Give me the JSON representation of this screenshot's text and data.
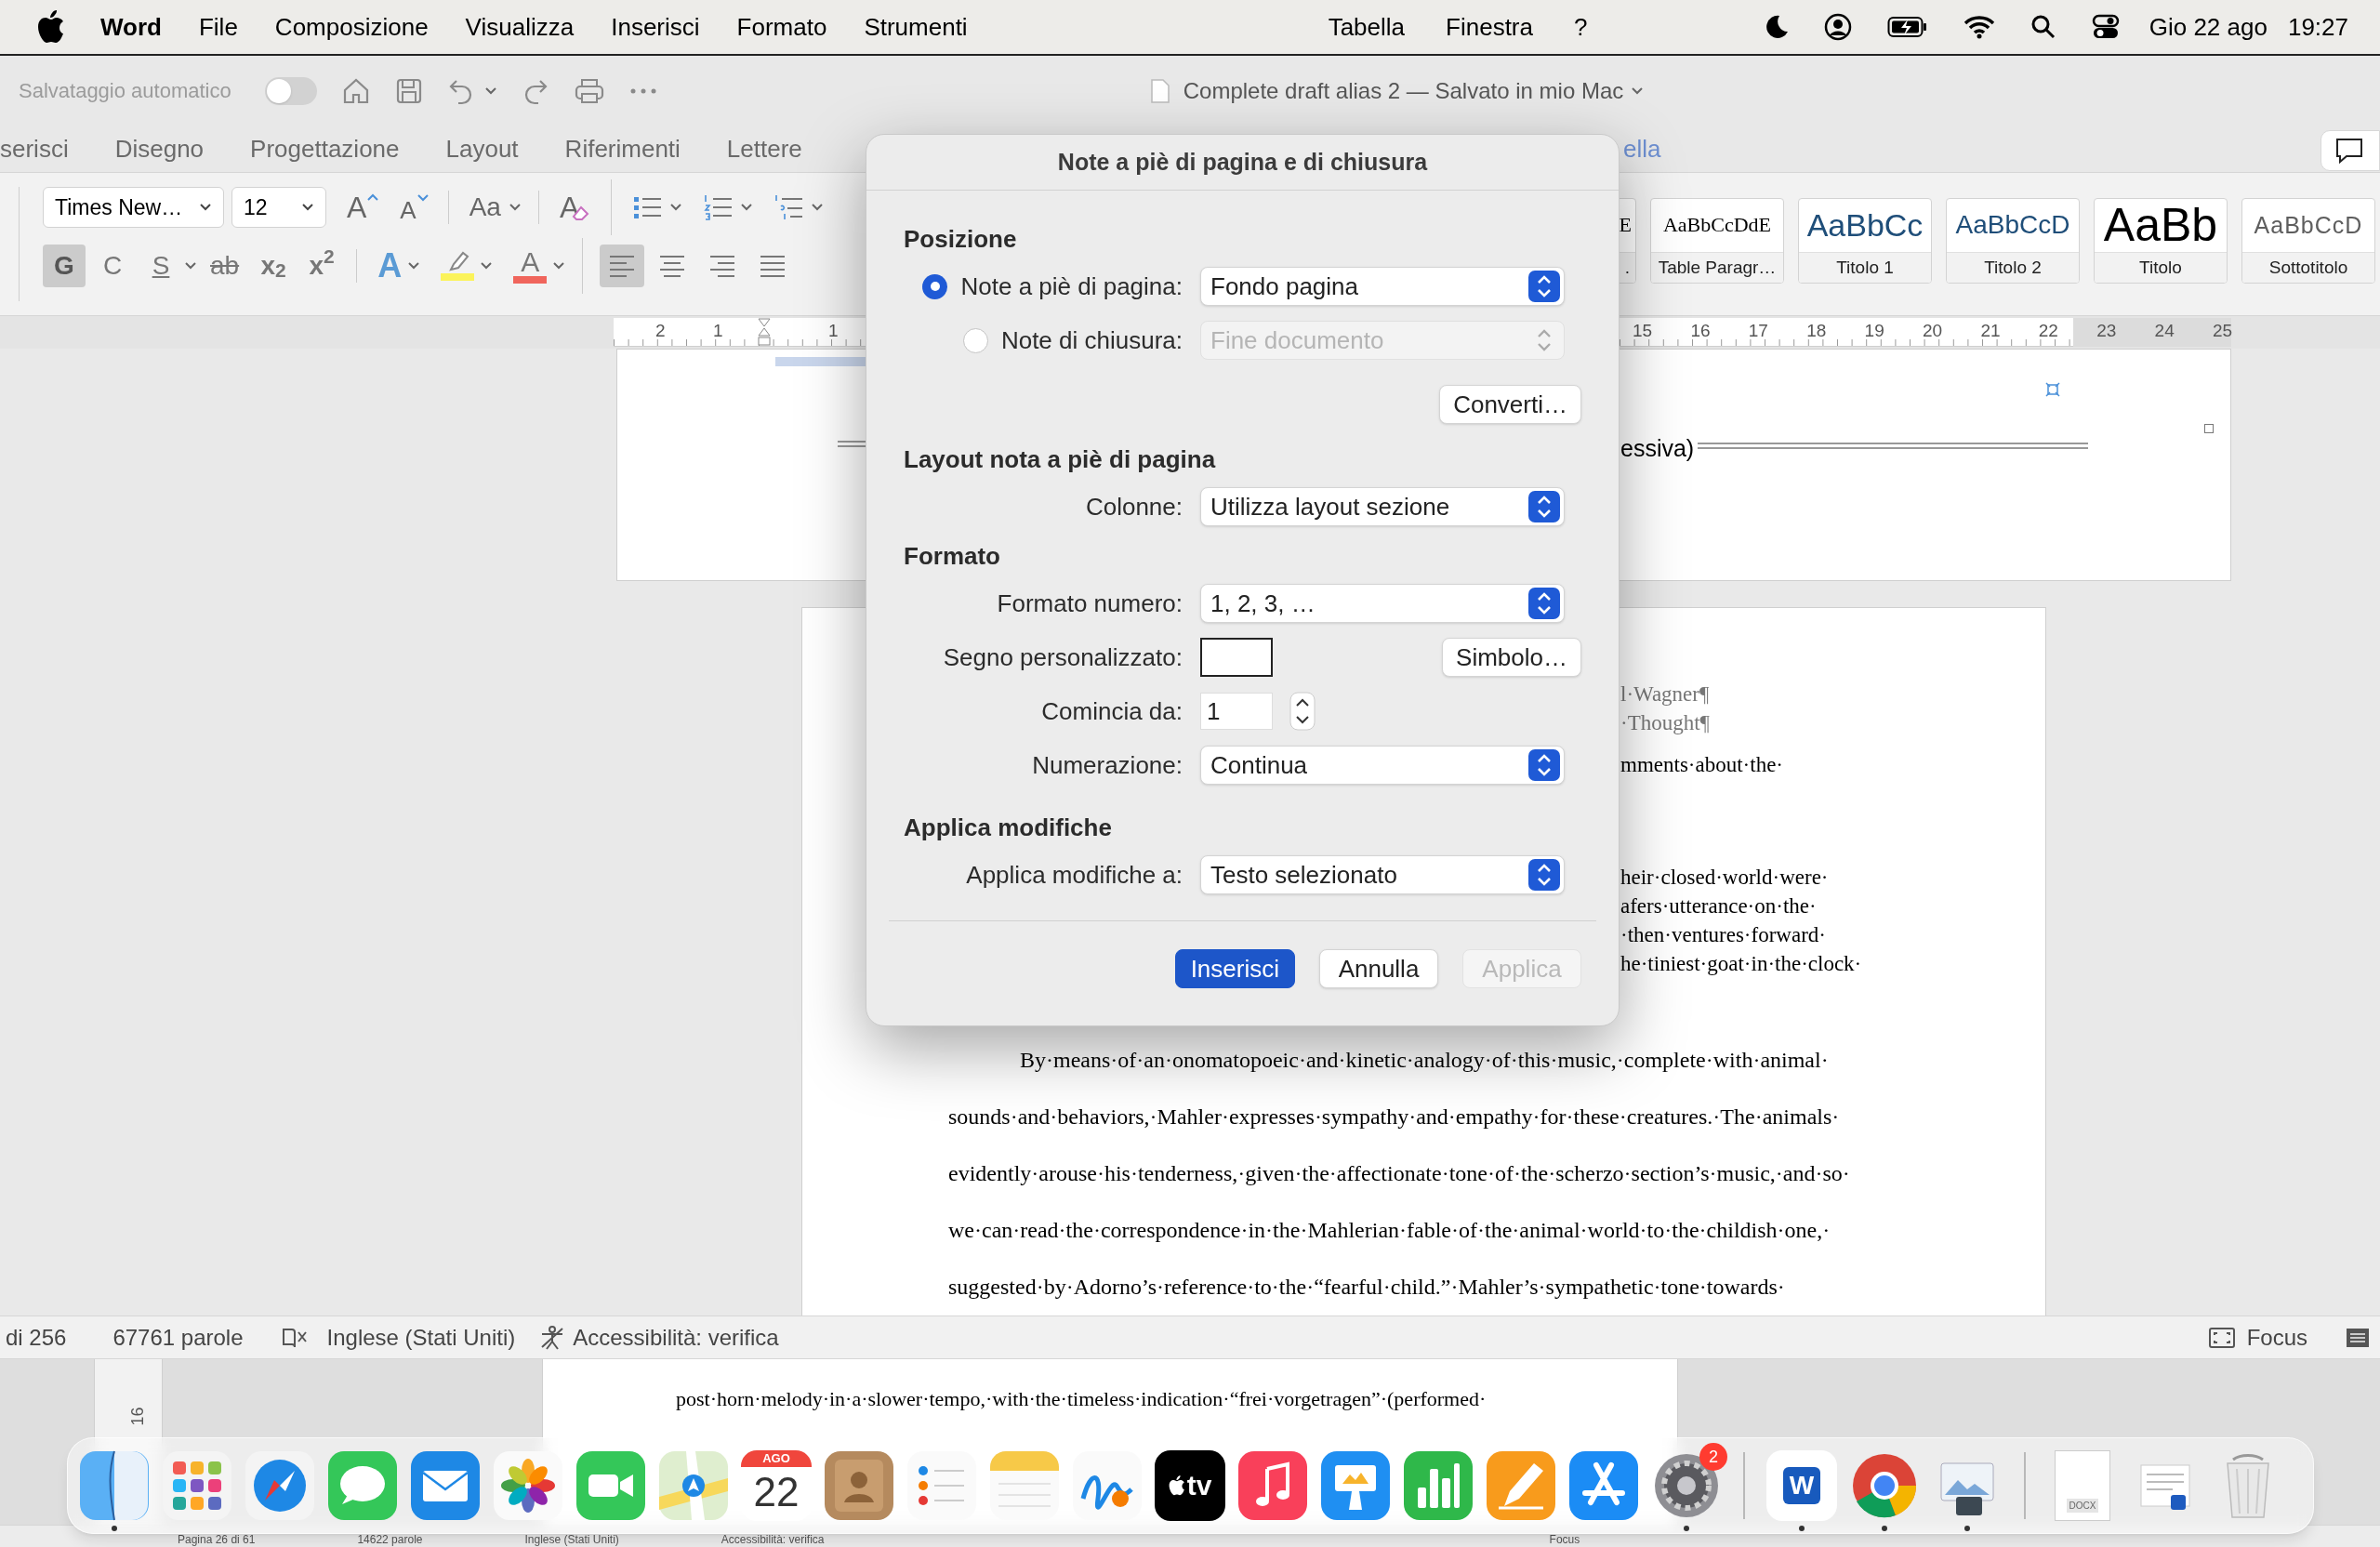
{
  "menu_bar": {
    "app_name": "Word",
    "menus": [
      "File",
      "Composizione",
      "Visualizza",
      "Inserisci",
      "Formato",
      "Strumenti"
    ],
    "extra_menus": [
      "Tabella",
      "Finestra",
      "?"
    ],
    "date": "Gio 22 ago",
    "time": "19:27"
  },
  "toolbar": {
    "autosave_label": "Salvataggio automatico",
    "autosave_on": false,
    "document_title": "Complete draft alias 2 — Salvato in mio Mac"
  },
  "ribbon_tabs": [
    {
      "label": "serisci",
      "contextual": false
    },
    {
      "label": "Disegno",
      "contextual": false
    },
    {
      "label": "Progettazione",
      "contextual": false
    },
    {
      "label": "Layout",
      "contextual": false
    },
    {
      "label": "Riferimenti",
      "contextual": false
    },
    {
      "label": "Lettere",
      "contextual": false
    },
    {
      "label": "ella",
      "contextual": true
    }
  ],
  "ribbon": {
    "font": "Times New…",
    "size": "12",
    "size_buttons": [
      {
        "label": "A",
        "kind": "grow"
      },
      {
        "label": "A",
        "kind": "shrink"
      }
    ],
    "change_case": "Aa",
    "clear_format": "A",
    "format_buttons": [
      {
        "label": "G",
        "kind": "bold",
        "selected": true
      },
      {
        "label": "C",
        "kind": "italic",
        "selected": false
      },
      {
        "label": "S",
        "kind": "underline",
        "selected": false
      },
      {
        "label": "ab",
        "kind": "strike",
        "selected": false
      },
      {
        "label": "x$_{2}$",
        "kind": "subscript",
        "selected": false
      },
      {
        "label": "x$^{2}$",
        "kind": "superscript",
        "selected": false
      }
    ],
    "color_buttons": [
      {
        "kind": "effects",
        "label": "A"
      },
      {
        "kind": "highlight",
        "color": "#fbf35a"
      },
      {
        "kind": "font-color",
        "label": "A",
        "color": "#f0655c"
      }
    ],
    "alignment": [
      {
        "kind": "left",
        "selected": true
      },
      {
        "kind": "center",
        "selected": false
      },
      {
        "kind": "right",
        "selected": false
      },
      {
        "kind": "justify",
        "selected": false
      }
    ],
    "styles": [
      {
        "kind": "partial",
        "sample": "E",
        "name": "."
      },
      {
        "kind": "serif",
        "sample": "AaBbCcDdE",
        "name": "Table Paragr…"
      },
      {
        "kind": "heading1",
        "sample": "AaBbCc",
        "name": "Titolo 1"
      },
      {
        "kind": "heading2",
        "sample": "AaBbCcD",
        "name": "Titolo 2"
      },
      {
        "kind": "title",
        "sample": "AaBb",
        "name": "Titolo"
      },
      {
        "kind": "subtitle",
        "sample": "AaBbCcD",
        "name": "Sottotitolo"
      }
    ]
  },
  "ruler": {
    "left_numbers": [
      "2",
      "1",
      "1"
    ],
    "right_numbers": [
      "15",
      "16",
      "17",
      "18",
      "19",
      "20",
      "21",
      "22",
      "23",
      "24",
      "25"
    ]
  },
  "document": {
    "page1_fragment": "essiva)",
    "fragment_groups": [
      [
        {
          "text": "l·Wagner¶",
          "kind": "heading"
        },
        {
          "text": "·Thought¶",
          "kind": "heading"
        }
      ],
      [
        {
          "text": "mments·about·the·",
          "kind": "body"
        }
      ],
      [
        {
          "text": "heir·closed·world·were·",
          "kind": "body"
        },
        {
          "text": "afers·utterance·on·the·",
          "kind": "body"
        },
        {
          "text": "·then·ventures·forward·",
          "kind": "body"
        },
        {
          "text": "he·tiniest·goat·in·the·clock·",
          "kind": "body"
        }
      ]
    ],
    "paragraph_lines": [
      "By·means·of·an·onomatopoeic·and·kinetic·analogy·of·this·music,·complete·with·animal·",
      "sounds·and·behaviors,·Mahler·expresses·sympathy·and·empathy·for·these·creatures.·The·animals·",
      "evidently·arouse·his·tenderness,·given·the·affectionate·tone·of·the·scherzo·section’s·music,·and·so·",
      "we·can·read·the·correspondence·in·the·Mahlerian·fable·of·the·animal·world·to·the·childish·one,·",
      "suggested·by·Adorno’s·reference·to·the·“fearful·child.”·Mahler’s·sympathetic·tone·towards·"
    ]
  },
  "status_bar": {
    "page": "di 256",
    "words": "67761 parole",
    "language": "Inglese (Stati Uniti)",
    "accessibility": "Accessibilità: verifica",
    "focus": "Focus"
  },
  "background_window": {
    "ruler_label": "16",
    "text_line": "post·horn·melody·in·a·slower·tempo,·with·the·timeless·indication·“frei·vorgetragen”·(performed·",
    "status_items": [
      "Pagina 26 di 61",
      "14622 parole",
      "Inglese (Stati Uniti)",
      "Accessibilità: verifica",
      "Focus"
    ]
  },
  "dialog": {
    "title": "Note a piè di pagina e di chiusura",
    "sections": [
      {
        "heading": "Posizione",
        "rows": [
          {
            "kind": "radio-popup",
            "label": "Note a piè di pagina:",
            "selected": true,
            "value": "Fondo pagina",
            "disabled": false
          },
          {
            "kind": "radio-popup",
            "label": "Note di chiusura:",
            "selected": false,
            "value": "Fine documento",
            "disabled": true
          },
          {
            "kind": "button",
            "button": "Converti…"
          }
        ]
      },
      {
        "heading": "Layout nota a piè di pagina",
        "rows": [
          {
            "kind": "popup",
            "label": "Colonne:",
            "value": "Utilizza layout sezione",
            "disabled": false
          }
        ]
      },
      {
        "heading": "Formato",
        "rows": [
          {
            "kind": "popup",
            "label": "Formato numero:",
            "value": "1, 2, 3, …",
            "disabled": false
          },
          {
            "kind": "mark-field",
            "label": "Segno personalizzato:",
            "button": "Simbolo…"
          },
          {
            "kind": "stepper",
            "label": "Comincia da:",
            "value": "1"
          },
          {
            "kind": "popup",
            "label": "Numerazione:",
            "value": "Continua",
            "disabled": false
          }
        ]
      },
      {
        "heading": "Applica modifiche",
        "rows": [
          {
            "kind": "popup",
            "label": "Applica modifiche a:",
            "value": "Testo selezionato",
            "disabled": false
          }
        ]
      }
    ],
    "buttons": [
      {
        "label": "Inserisci",
        "kind": "primary",
        "disabled": false
      },
      {
        "label": "Annulla",
        "kind": "normal",
        "disabled": false
      },
      {
        "label": "Applica",
        "kind": "normal",
        "disabled": true
      }
    ]
  },
  "dock": {
    "items": [
      {
        "kind": "finder",
        "running": true
      },
      {
        "kind": "launchpad",
        "running": false
      },
      {
        "kind": "safari",
        "running": false
      },
      {
        "kind": "messages",
        "running": false
      },
      {
        "kind": "mail",
        "running": false
      },
      {
        "kind": "photos",
        "running": false
      },
      {
        "kind": "facetime",
        "running": false
      },
      {
        "kind": "maps",
        "running": false
      },
      {
        "kind": "calendar",
        "month": "AGO",
        "day": "22",
        "running": false
      },
      {
        "kind": "contacts",
        "running": false
      },
      {
        "kind": "reminders",
        "running": false
      },
      {
        "kind": "notes",
        "running": false
      },
      {
        "kind": "freeform",
        "running": false
      },
      {
        "kind": "tv",
        "label": "tv",
        "running": false
      },
      {
        "kind": "music",
        "running": false
      },
      {
        "kind": "keynote",
        "running": false
      },
      {
        "kind": "numbers",
        "running": false
      },
      {
        "kind": "pages",
        "running": false
      },
      {
        "kind": "appstore",
        "running": false
      },
      {
        "kind": "settings",
        "badge": "2",
        "running": true
      },
      {
        "kind": "separator"
      },
      {
        "kind": "word",
        "label": "W",
        "running": true
      },
      {
        "kind": "chrome",
        "running": true
      },
      {
        "kind": "preview",
        "running": true
      },
      {
        "kind": "separator"
      },
      {
        "kind": "docx",
        "label": "DOCX"
      },
      {
        "kind": "doc"
      },
      {
        "kind": "trash"
      }
    ]
  }
}
